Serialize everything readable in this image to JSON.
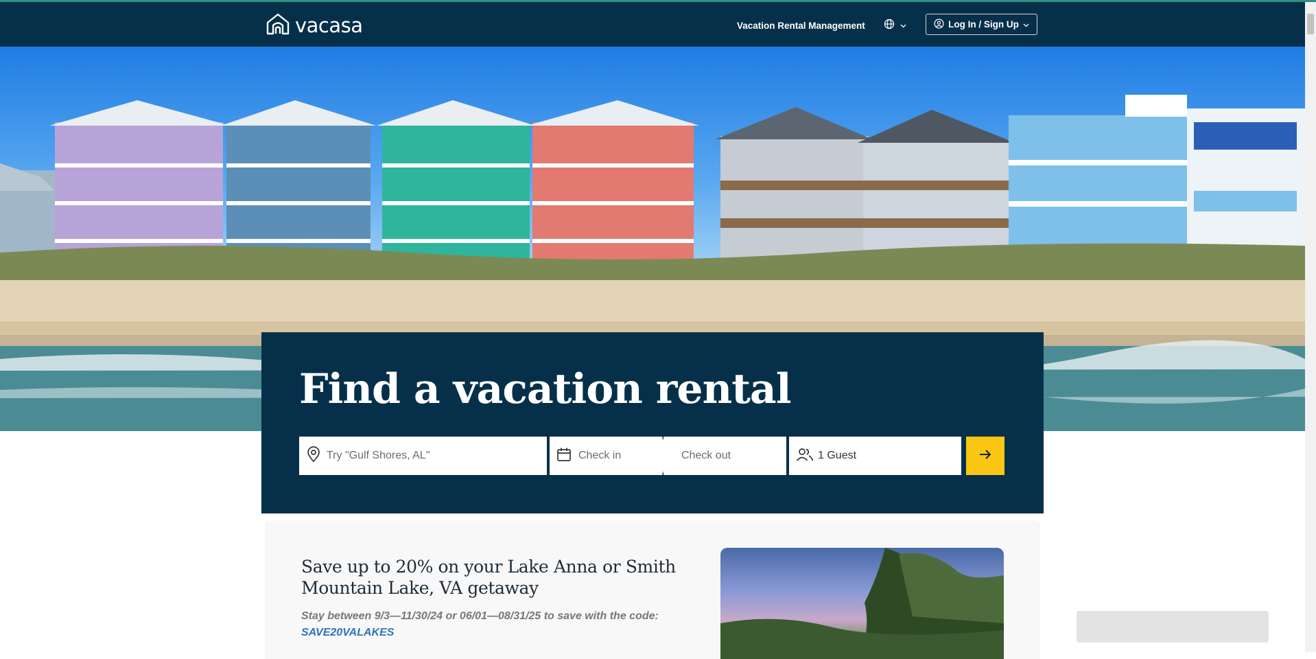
{
  "nav": {
    "logo_text": "vacasa",
    "management_link": "Vacation Rental Management",
    "login_label": "Log In / Sign Up"
  },
  "search": {
    "headline": "Find a vacation rental",
    "location_placeholder": "Try \"Gulf Shores, AL\"",
    "checkin_label": "Check in",
    "checkout_label": "Check out",
    "guests_label": "1 Guest"
  },
  "promo": {
    "title": "Save up to 20% on your Lake Anna or Smith Mountain Lake, VA getaway",
    "description": "Stay between 9/3—11/30/24 or 06/01—08/31/25 to save with the code:",
    "code": "SAVE20VALAKES"
  },
  "icons": {
    "logo": "house-outline-icon",
    "globe": "globe-icon",
    "user": "user-circle-icon",
    "location": "map-pin-icon",
    "calendar": "calendar-icon",
    "guests": "users-icon",
    "submit": "arrow-right-icon"
  },
  "colors": {
    "nav_bg": "#06304a",
    "panel_bg": "#06304a",
    "accent_yellow": "#f9c712",
    "code_blue": "#2d74b9"
  }
}
